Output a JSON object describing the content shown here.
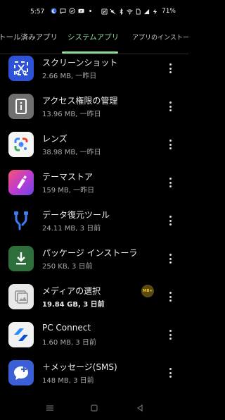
{
  "status_bar": {
    "time": "5:57",
    "battery_percent": "71%",
    "left_icons": [
      "moon-icon",
      "message-icon",
      "check-circle-icon",
      "youtube-icon",
      "dot-icon"
    ],
    "right_icons": [
      "nfc-icon",
      "mute-icon",
      "bluetooth-icon",
      "wifi-icon",
      "sim-icon",
      "signal-icon",
      "charging-icon"
    ]
  },
  "tabs": [
    {
      "label": "トール済みアプリ",
      "active": false
    },
    {
      "label": "システムアプリ",
      "active": true
    },
    {
      "label": "アプリのインストー",
      "active": false
    }
  ],
  "apps": [
    {
      "name": "スクリーンショット",
      "meta": "2.66 MB, 一昨日",
      "icon": "screenshot-icon"
    },
    {
      "name": "アクセス権限の管理",
      "meta": "13.96 MB, 一昨日",
      "icon": "permission-icon"
    },
    {
      "name": "レンズ",
      "meta": "38.98 MB, 一昨日",
      "icon": "lens-icon"
    },
    {
      "name": "テーマストア",
      "meta": "159 MB, 一昨日",
      "icon": "theme-store-icon"
    },
    {
      "name": "データ復元ツール",
      "meta": "24.11 MB, 3 日前",
      "icon": "data-restore-icon"
    },
    {
      "name": "パッケージ インストーラ",
      "meta": "250 KB, 3 日前",
      "icon": "package-installer-icon"
    },
    {
      "name": "メディアの選択",
      "meta": "19.84 GB, 3 日前",
      "icon": "media-picker-icon",
      "highlight": true,
      "badge": "MB+"
    },
    {
      "name": "PC Connect",
      "meta": "1.60 MB, 3 日前",
      "icon": "pc-connect-icon"
    },
    {
      "name": "＋メッセージ(SMS)",
      "meta": "148 MB, 3 日前",
      "icon": "plus-message-icon"
    }
  ],
  "nav_bar": [
    "menu-icon",
    "home-icon",
    "back-icon"
  ],
  "colors": {
    "background": "#000000",
    "accent": "#8fd99a",
    "text_primary": "#ececec",
    "text_secondary": "#a9a9a9"
  }
}
